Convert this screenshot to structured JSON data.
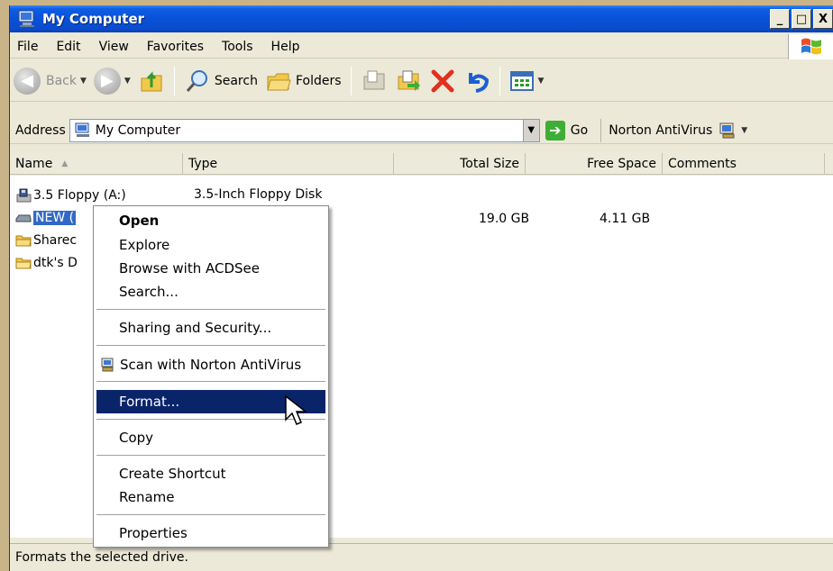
{
  "window": {
    "title": "My Computer",
    "minimize": "_",
    "maximize": "□",
    "close": "X"
  },
  "menubar": [
    "File",
    "Edit",
    "View",
    "Favorites",
    "Tools",
    "Help"
  ],
  "toolbar": {
    "back": "Back",
    "search": "Search",
    "folders": "Folders"
  },
  "address": {
    "label": "Address",
    "value": "My Computer",
    "go": "Go",
    "norton": "Norton AntiVirus"
  },
  "columns": [
    {
      "label": "Name",
      "sort": "▲"
    },
    {
      "label": "Type"
    },
    {
      "label": "Total Size"
    },
    {
      "label": "Free Space"
    },
    {
      "label": "Comments"
    }
  ],
  "items": [
    {
      "name": "3.5 Floppy (A:)",
      "type": "3.5-Inch Floppy Disk",
      "total": "",
      "free": ""
    },
    {
      "name": "NEW (",
      "type": "",
      "total": "19.0 GB",
      "free": "4.11 GB"
    },
    {
      "name": "Sharec",
      "type": "",
      "total": "",
      "free": ""
    },
    {
      "name": "dtk's D",
      "type": "",
      "total": "",
      "free": ""
    }
  ],
  "context_menu": [
    "Open",
    "Explore",
    "Browse with ACDSee",
    "Search...",
    "Sharing and Security...",
    "Scan with Norton AntiVirus",
    "Format...",
    "Copy",
    "Create Shortcut",
    "Rename",
    "Properties"
  ],
  "status": "Formats the selected drive.",
  "colors": {
    "titlebar": "#0851d6",
    "selection": "#316ac5",
    "menu_highlight": "#0a246a"
  }
}
